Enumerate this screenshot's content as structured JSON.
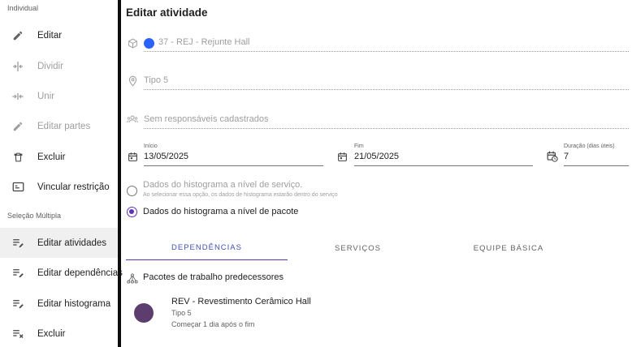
{
  "sidebar": {
    "individual_label": "Individual",
    "multiple_label": "Seleção Múltipla",
    "items": [
      {
        "label": "Editar",
        "icon": "pencil-icon",
        "disabled": false
      },
      {
        "label": "Dividir",
        "icon": "split-icon",
        "disabled": true
      },
      {
        "label": "Unir",
        "icon": "merge-icon",
        "disabled": true
      },
      {
        "label": "Editar partes",
        "icon": "pencil-icon",
        "disabled": true
      },
      {
        "label": "Excluir",
        "icon": "trash-icon",
        "disabled": false
      },
      {
        "label": "Vincular restrição",
        "icon": "restriction-icon",
        "disabled": false
      }
    ],
    "multi_items": [
      {
        "label": "Editar atividades",
        "icon": "edit-list-icon",
        "active": true
      },
      {
        "label": "Editar dependências",
        "icon": "edit-list-icon",
        "active": false
      },
      {
        "label": "Editar histograma",
        "icon": "edit-list-icon",
        "active": false
      },
      {
        "label": "Excluir",
        "icon": "list-remove-icon",
        "active": false
      }
    ]
  },
  "main": {
    "title": "Editar atividade",
    "package_field": "37 - REJ - Rejunte Hall",
    "type_field": "Tipo 5",
    "responsibles_field": "Sem responsáveis cadastrados",
    "start": {
      "label": "Início",
      "value": "13/05/2025"
    },
    "end": {
      "label": "Fim",
      "value": "21/05/2025"
    },
    "duration": {
      "label": "Duração (dias úteis)",
      "value": "7"
    },
    "radio_service": {
      "label": "Dados do histograma a nível de serviço.",
      "hint": "Ao selecionar essa opção, os dados de histograma estarão dentro do serviço"
    },
    "radio_package": {
      "label": "Dados do histograma a nível de pacote"
    },
    "tabs": [
      "DEPENDÊNCIAS",
      "SERVIÇOS",
      "EQUIPE BÁSICA"
    ],
    "predecessors_title": "Pacotes de trabalho predecessores",
    "predecessor": {
      "title": "REV - Revestimento Cerâmico Hall",
      "type": "Tipo 5",
      "relation": "Começar 1 dia após o fim"
    }
  },
  "colors": {
    "accent": "#5e35b1",
    "tab_active_text": "#3f51b5",
    "package_dot": "#2962ff",
    "avatar": "#5c3d6e"
  }
}
